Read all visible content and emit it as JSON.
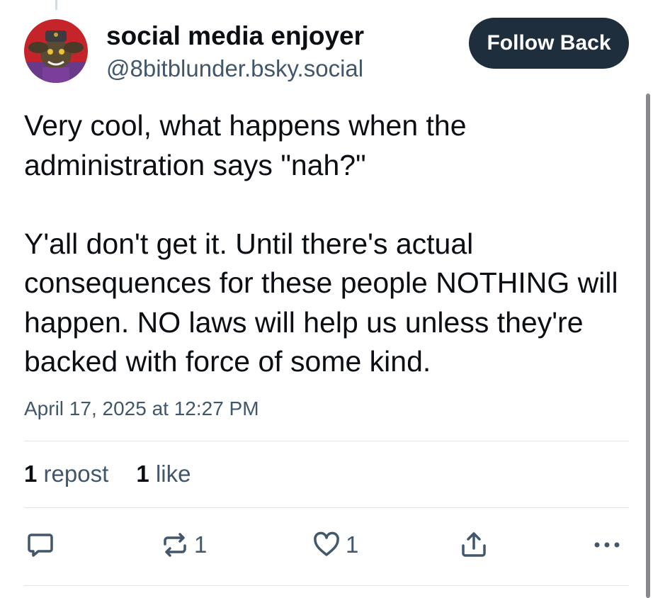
{
  "post": {
    "author": {
      "display_name": "social media enjoyer",
      "handle": "@8bitblunder.bsky.social"
    },
    "follow_button_label": "Follow Back",
    "text": {
      "paragraph_1": "Very cool, what happens when the administration says \"nah?\"",
      "paragraph_2": "Y'all don't get it. Until there's actual consequences for these people NOTHING will happen. NO laws will help us unless they're backed with force of some kind."
    },
    "timestamp": "April 17, 2025 at 12:27 PM",
    "stats": {
      "reposts_count": "1",
      "reposts_label": "repost",
      "likes_count": "1",
      "likes_label": "like"
    },
    "actions": {
      "reply_icon": "reply-icon",
      "repost_icon": "repost-icon",
      "repost_count": "1",
      "like_icon": "heart-icon",
      "like_count": "1",
      "share_icon": "share-icon",
      "more_icon": "more-icon"
    }
  },
  "colors": {
    "text_primary": "#0b0f14",
    "text_secondary": "#42576c",
    "button_background": "#1f2e3d",
    "divider": "#e0e5ea"
  }
}
